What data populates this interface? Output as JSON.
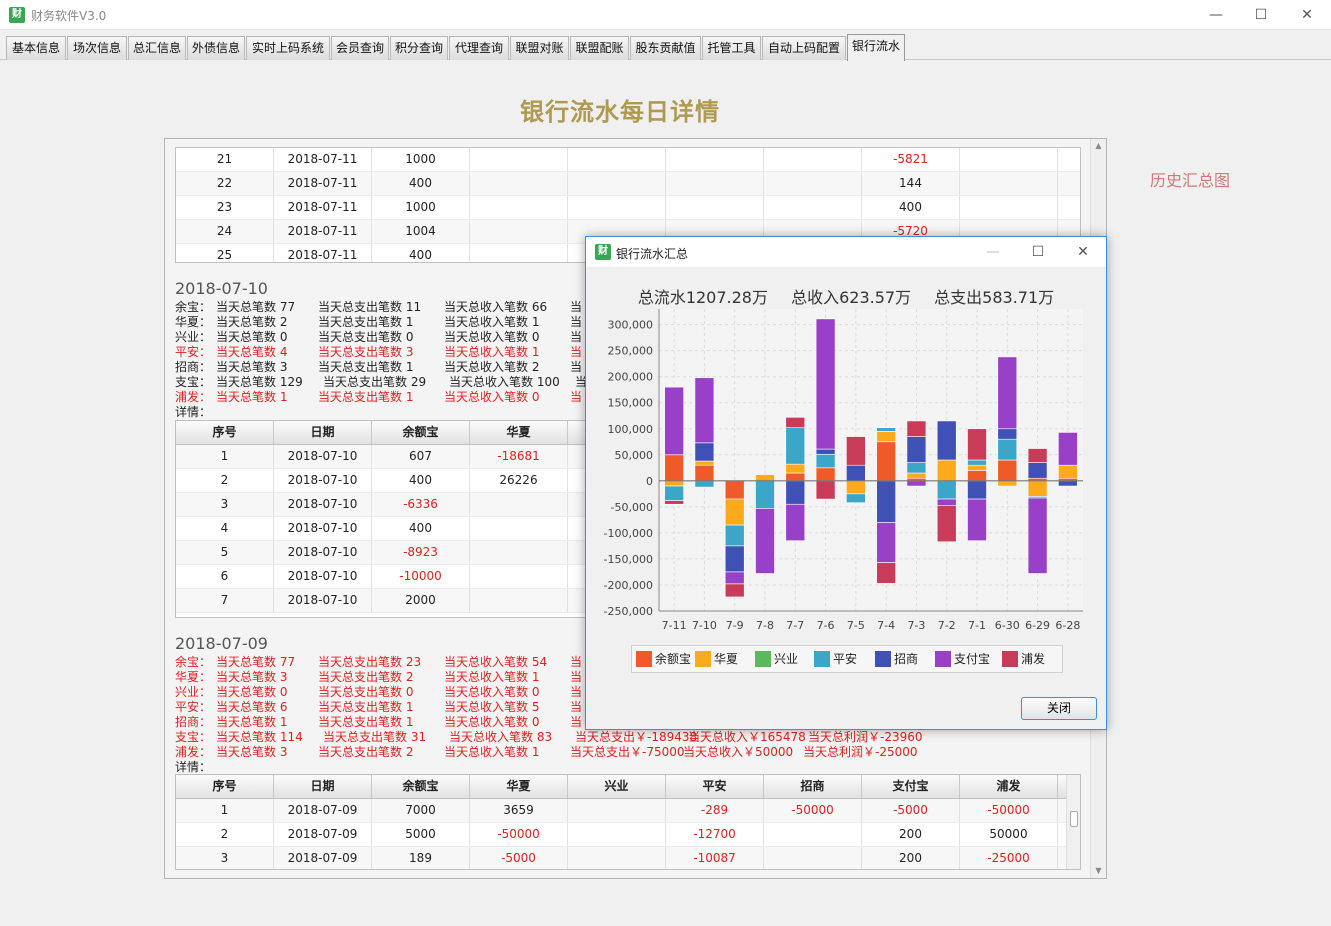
{
  "window": {
    "title": "财务软件V3.0",
    "minimize": "—",
    "maximize": "☐",
    "close": "✕",
    "icon_text": "财"
  },
  "tabs": [
    "基本信息",
    "场次信息",
    "总汇信息",
    "外债信息",
    "实时上码系统",
    "会员查询",
    "积分查询",
    "代理查询",
    "联盟对账",
    "联盟配账",
    "股东贡献值",
    "托管工具",
    "自动上码配置",
    "银行流水"
  ],
  "active_tab": "银行流水",
  "page_title": "银行流水每日详情",
  "history_link": "历史汇总图",
  "columns": [
    "序号",
    "日期",
    "余额宝",
    "华夏",
    "兴业",
    "平安",
    "招商",
    "支付宝",
    "浦发"
  ],
  "detail_label": "详情：",
  "top_table_rows": [
    [
      "21",
      "2018-07-11",
      "1000",
      "",
      "",
      "",
      "",
      "-5821",
      ""
    ],
    [
      "22",
      "2018-07-11",
      "400",
      "",
      "",
      "",
      "",
      "144",
      ""
    ],
    [
      "23",
      "2018-07-11",
      "1000",
      "",
      "",
      "",
      "",
      "400",
      ""
    ],
    [
      "24",
      "2018-07-11",
      "1004",
      "",
      "",
      "",
      "",
      "-5720",
      ""
    ],
    [
      "25",
      "2018-07-11",
      "400",
      "",
      "",
      "",
      "",
      "",
      ""
    ]
  ],
  "day_0710": {
    "date": "2018-07-10",
    "summaries": [
      {
        "bank": "余宝：",
        "p1": "当天总笔数 77",
        "p2": "当天总支出笔数 11",
        "p3": "当天总收入笔数 66",
        "p4": "当"
      },
      {
        "bank": "华夏：",
        "p1": "当天总笔数 2",
        "p2": "当天总支出笔数 1",
        "p3": "当天总收入笔数 1",
        "p4": "当"
      },
      {
        "bank": "兴业：",
        "p1": "当天总笔数 0",
        "p2": "当天总支出笔数 0",
        "p3": "当天总收入笔数 0",
        "p4": "当"
      },
      {
        "bank": "平安：",
        "p1": "当天总笔数 4",
        "p2": "当天总支出笔数 3",
        "p3": "当天总收入笔数 1",
        "p4": "当"
      },
      {
        "bank": "招商：",
        "p1": "当天总笔数 3",
        "p2": "当天总支出笔数 1",
        "p3": "当天总收入笔数 2",
        "p4": "当"
      },
      {
        "bank": "支宝：",
        "p1": "当天总笔数 129",
        "p2": "当天总支出笔数 29",
        "p3": "当天总收入笔数 100",
        "p4": "当"
      },
      {
        "bank": "浦发：",
        "p1": "当天总笔数 1",
        "p2": "当天总支出笔数 1",
        "p3": "当天总收入笔数 0",
        "p4": "当"
      }
    ],
    "rows": [
      [
        "1",
        "2018-07-10",
        "607",
        "-18681",
        "",
        "",
        "",
        "",
        ""
      ],
      [
        "2",
        "2018-07-10",
        "400",
        "26226",
        "",
        "",
        "",
        "",
        ""
      ],
      [
        "3",
        "2018-07-10",
        "-6336",
        "",
        "",
        "",
        "",
        "",
        ""
      ],
      [
        "4",
        "2018-07-10",
        "400",
        "",
        "",
        "",
        "",
        "",
        ""
      ],
      [
        "5",
        "2018-07-10",
        "-8923",
        "",
        "",
        "",
        "",
        "",
        ""
      ],
      [
        "6",
        "2018-07-10",
        "-10000",
        "",
        "",
        "",
        "",
        "",
        ""
      ],
      [
        "7",
        "2018-07-10",
        "2000",
        "",
        "",
        "",
        "",
        "",
        ""
      ]
    ]
  },
  "day_0709": {
    "date": "2018-07-09",
    "summaries": [
      {
        "bank": "余宝：",
        "p1": "当天总笔数 77",
        "p2": "当天总支出笔数 23",
        "p3": "当天总收入笔数 54",
        "p4": "当",
        "p5": "",
        "p6": ""
      },
      {
        "bank": "华夏：",
        "p1": "当天总笔数 3",
        "p2": "当天总支出笔数 2",
        "p3": "当天总收入笔数 1",
        "p4": "当",
        "p5": "",
        "p6": ""
      },
      {
        "bank": "兴业：",
        "p1": "当天总笔数 0",
        "p2": "当天总支出笔数 0",
        "p3": "当天总收入笔数 0",
        "p4": "当",
        "p5": "",
        "p6": ""
      },
      {
        "bank": "平安：",
        "p1": "当天总笔数 6",
        "p2": "当天总支出笔数 1",
        "p3": "当天总收入笔数 5",
        "p4": "当",
        "p5": "",
        "p6": ""
      },
      {
        "bank": "招商：",
        "p1": "当天总笔数 1",
        "p2": "当天总支出笔数 1",
        "p3": "当天总收入笔数 0",
        "p4": "当",
        "p5": "",
        "p6": ""
      },
      {
        "bank": "支宝：",
        "p1": "当天总笔数 114",
        "p2": "当天总支出笔数 31",
        "p3": "当天总收入笔数 83",
        "p4": "当天总支出￥-189438",
        "p5": "当天总收入￥165478",
        "p6": "当天总利润￥-23960"
      },
      {
        "bank": "浦发：",
        "p1": "当天总笔数 3",
        "p2": "当天总支出笔数 2",
        "p3": "当天总收入笔数 1",
        "p4": "当天总支出￥-75000",
        "p5": "当天总收入￥50000",
        "p6": "当天总利润￥-25000"
      }
    ],
    "rows": [
      [
        "1",
        "2018-07-09",
        "7000",
        "3659",
        "",
        "-289",
        "-50000",
        "-5000",
        "-50000"
      ],
      [
        "2",
        "2018-07-09",
        "5000",
        "-50000",
        "",
        "-12700",
        "",
        "200",
        "50000"
      ],
      [
        "3",
        "2018-07-09",
        "189",
        "-5000",
        "",
        "-10087",
        "",
        "200",
        "-25000"
      ]
    ]
  },
  "dialog": {
    "title": "银行流水汇总",
    "total_flow": "总流水1207.28万",
    "total_income": "总收入623.57万",
    "total_expense": "总支出583.71万",
    "close_label": "关闭"
  },
  "chart_data": {
    "type": "bar",
    "stacked": true,
    "categories": [
      "7-11",
      "7-10",
      "7-9",
      "7-8",
      "7-7",
      "7-6",
      "7-5",
      "7-4",
      "7-3",
      "7-2",
      "7-1",
      "6-30",
      "6-29",
      "6-28"
    ],
    "ylim": [
      -250000,
      330000
    ],
    "yticks": [
      -250000,
      -200000,
      -150000,
      -100000,
      -50000,
      0,
      50000,
      100000,
      150000,
      200000,
      250000,
      300000
    ],
    "grid": true,
    "legend_position": "bottom",
    "series": [
      {
        "name": "余额宝",
        "color": "#f05a28",
        "values": [
          50000,
          30000,
          -35000,
          0,
          15000,
          25000,
          0,
          75000,
          5000,
          0,
          20000,
          40000,
          5000,
          5000
        ]
      },
      {
        "name": "华夏",
        "color": "#fbaa1c",
        "values": [
          -10000,
          8000,
          -50000,
          12000,
          17000,
          0,
          -25000,
          20000,
          10000,
          40000,
          10000,
          -10000,
          -30000,
          25000
        ]
      },
      {
        "name": "兴业",
        "color": "#5cb85c",
        "values": [
          0,
          0,
          0,
          0,
          0,
          0,
          0,
          0,
          0,
          0,
          0,
          0,
          0,
          0
        ]
      },
      {
        "name": "平安",
        "color": "#3ca6c8",
        "values": [
          -28000,
          -12000,
          -40000,
          -53000,
          70000,
          26000,
          -17000,
          7000,
          20000,
          -35000,
          10000,
          40000,
          -3000,
          0
        ]
      },
      {
        "name": "招商",
        "color": "#3f51b5",
        "values": [
          0,
          35000,
          -50000,
          0,
          -45000,
          10000,
          30000,
          -80000,
          50000,
          75000,
          -35000,
          20000,
          30000,
          -10000
        ]
      },
      {
        "name": "支付宝",
        "color": "#9940c8",
        "values": [
          130000,
          125000,
          -23000,
          -125000,
          -70000,
          250000,
          0,
          -77000,
          -10000,
          -12000,
          -80000,
          138000,
          -145000,
          63000
        ]
      },
      {
        "name": "浦发",
        "color": "#c83c5a",
        "values": [
          -7000,
          0,
          -25000,
          0,
          20000,
          -35000,
          55000,
          -40000,
          30000,
          -70000,
          60000,
          0,
          27000,
          0
        ]
      }
    ]
  }
}
